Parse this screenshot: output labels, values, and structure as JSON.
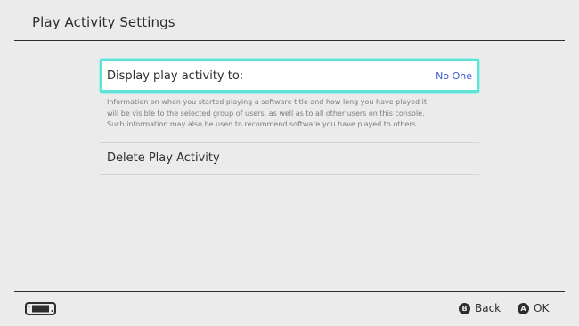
{
  "header": {
    "title": "Play Activity Settings"
  },
  "settings": {
    "display_activity": {
      "label": "Display play activity to:",
      "value": "No One",
      "description": [
        "Information on when you started playing a software title and how long you have played it",
        "will be visible to the selected group of users, as well as to all other users on this console.",
        "Such information may also be used to recommend software you have played to others."
      ]
    },
    "delete_activity": {
      "label": "Delete Play Activity"
    }
  },
  "footer": {
    "console_icon": "handheld-console-icon",
    "back": {
      "glyph": "B",
      "label": "Back"
    },
    "ok": {
      "glyph": "A",
      "label": "OK"
    }
  },
  "colors": {
    "background": "#ebebeb",
    "highlight": "#5fe3d8",
    "value_text": "#3a5bd0"
  }
}
